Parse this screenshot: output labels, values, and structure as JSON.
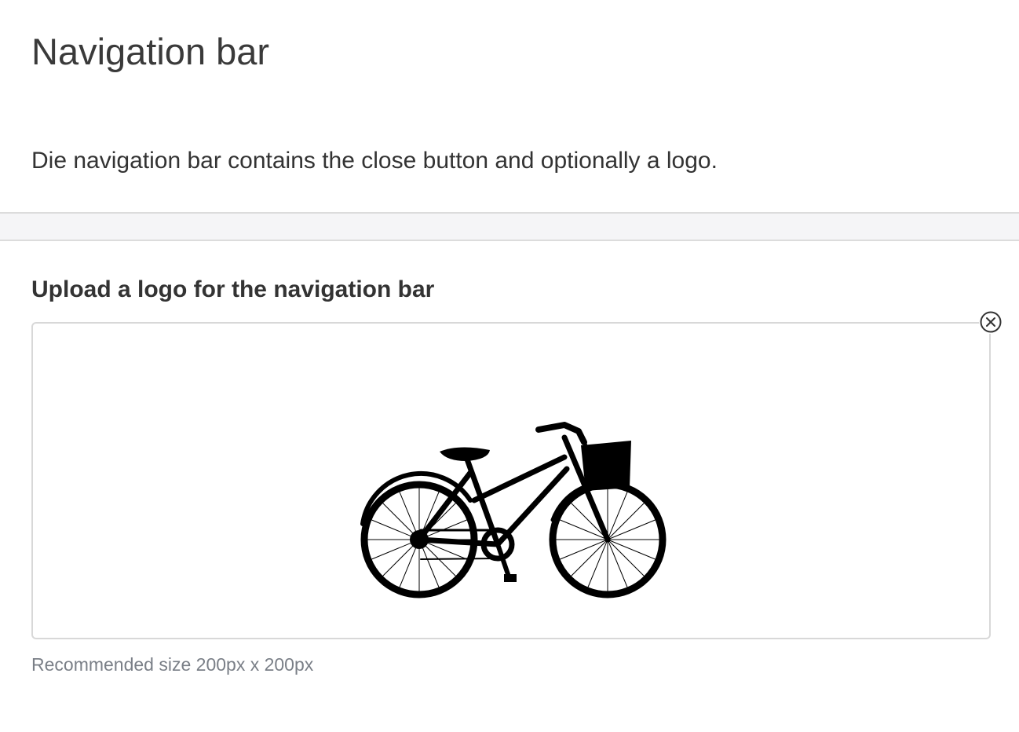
{
  "page": {
    "title": "Navigation bar",
    "description": "Die navigation bar contains the close button and optionally a logo."
  },
  "logo_upload": {
    "label": "Upload a logo for the navigation bar",
    "hint": "Recommended size 200px x 200px",
    "preview_image": "bicycle-silhouette",
    "remove_icon": "close-circle-icon"
  },
  "colors": {
    "divider_band": "#f5f5f7",
    "border": "#d8d8d8",
    "hint_text": "#7a7f87"
  }
}
